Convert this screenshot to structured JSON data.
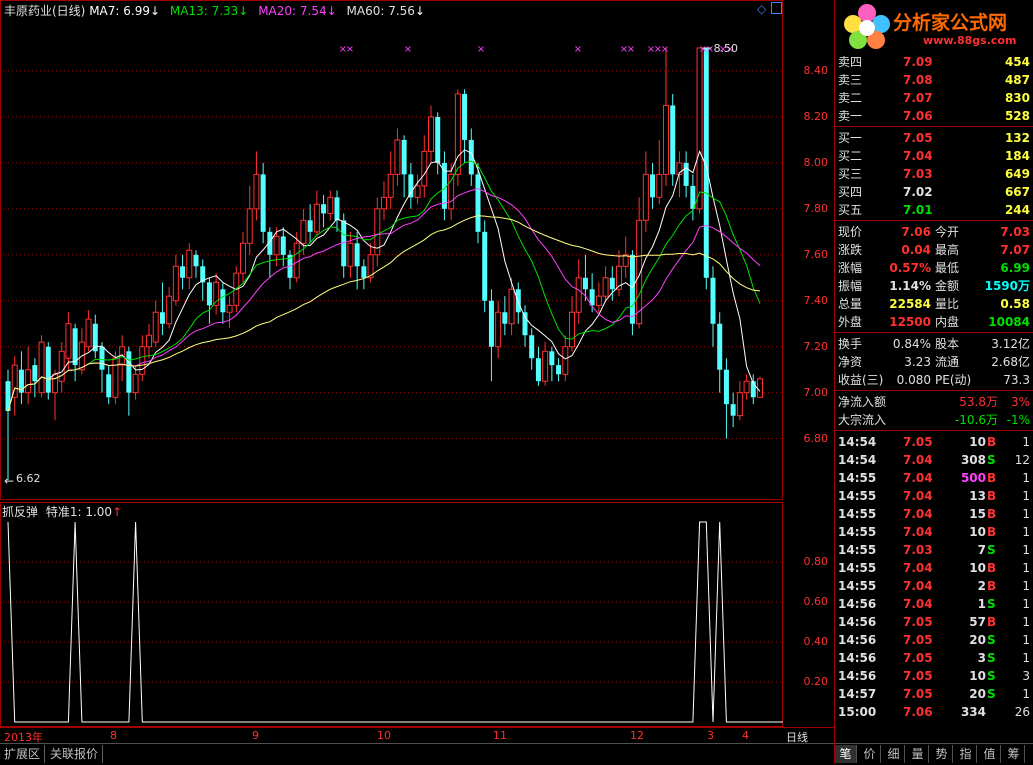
{
  "header": {
    "title": "丰原药业(日线)",
    "ma7": "MA7: 6.99",
    "ma13": "MA13: 7.33",
    "ma20": "MA20: 7.54",
    "ma60": "MA60: 7.56",
    "arrow": "↓"
  },
  "colors": {
    "ma7": "#ffffff",
    "ma13": "#00e000",
    "ma20": "#ff40ff",
    "ma60": "#ffff80",
    "up": "#ff3030",
    "down": "#54ffff",
    "grid": "#a00000"
  },
  "main_axis_ticks": [
    "8.40",
    "8.20",
    "8.00",
    "7.80",
    "7.60",
    "7.40",
    "7.20",
    "7.00",
    "6.80"
  ],
  "main_annotations": {
    "high": "8.50",
    "low": "6.62"
  },
  "sub_header": {
    "name": "抓反弹",
    "param": "特准1: 1.00",
    "arrow": "↑"
  },
  "sub_axis_ticks": [
    "0.80",
    "0.60",
    "0.40",
    "0.20"
  ],
  "dates": [
    "2013年",
    "8",
    "9",
    "10",
    "11",
    "12",
    "3",
    "4"
  ],
  "period_label": "日线",
  "bottom_tabs": [
    "扩展区",
    "关联报价"
  ],
  "panel": {
    "logo_text": "分析家公式网",
    "logo_url": "www.88gs.com",
    "sell": [
      {
        "label": "卖四",
        "price": "7.09",
        "vol": "454"
      },
      {
        "label": "卖三",
        "price": "7.08",
        "vol": "487"
      },
      {
        "label": "卖二",
        "price": "7.07",
        "vol": "830"
      },
      {
        "label": "卖一",
        "price": "7.06",
        "vol": "528"
      }
    ],
    "buy": [
      {
        "label": "买一",
        "price": "7.05",
        "vol": "132"
      },
      {
        "label": "买二",
        "price": "7.04",
        "vol": "184"
      },
      {
        "label": "买三",
        "price": "7.03",
        "vol": "649"
      },
      {
        "label": "买四",
        "price": "7.02",
        "vol": "667"
      },
      {
        "label": "买五",
        "price": "7.01",
        "vol": "244"
      }
    ],
    "stats": [
      {
        "l1": "现价",
        "v1": "7.06",
        "c1": "r",
        "l2": "今开",
        "v2": "7.03",
        "c2": "r"
      },
      {
        "l1": "涨跌",
        "v1": "0.04",
        "c1": "r",
        "l2": "最高",
        "v2": "7.07",
        "c2": "r"
      },
      {
        "l1": "涨幅",
        "v1": "0.57%",
        "c1": "r",
        "l2": "最低",
        "v2": "6.99",
        "c2": "g"
      },
      {
        "l1": "振幅",
        "v1": "1.14%",
        "c1": "w",
        "l2": "金额",
        "v2": "1590万",
        "c2": "cy"
      },
      {
        "l1": "总量",
        "v1": "22584",
        "c1": "y",
        "l2": "量比",
        "v2": "0.58",
        "c2": "y"
      },
      {
        "l1": "外盘",
        "v1": "12500",
        "c1": "r",
        "l2": "内盘",
        "v2": "10084",
        "c2": "g"
      }
    ],
    "stats2": [
      {
        "l1": "换手",
        "v1": "0.84%",
        "l2": "股本",
        "v2": "3.12亿"
      },
      {
        "l1": "净资",
        "v1": "3.23",
        "l2": "流通",
        "v2": "2.68亿"
      },
      {
        "l1": "收益(三)",
        "v1": "0.080",
        "l2": "PE(动)",
        "v2": "73.3"
      }
    ],
    "flow": [
      {
        "label": "净流入额",
        "val": "53.8万",
        "pct": "3%",
        "color": "r"
      },
      {
        "label": "大宗流入",
        "val": "-10.6万",
        "pct": "-1%",
        "color": "g"
      }
    ],
    "ticks": [
      {
        "t": "14:54",
        "p": "7.05",
        "v": "10",
        "bs": "B",
        "n": "1",
        "vc": "w"
      },
      {
        "t": "14:54",
        "p": "7.04",
        "v": "308",
        "bs": "S",
        "n": "12",
        "vc": "w"
      },
      {
        "t": "14:55",
        "p": "7.04",
        "v": "500",
        "bs": "B",
        "n": "1",
        "vc": "mg"
      },
      {
        "t": "14:55",
        "p": "7.04",
        "v": "13",
        "bs": "B",
        "n": "1",
        "vc": "w"
      },
      {
        "t": "14:55",
        "p": "7.04",
        "v": "15",
        "bs": "B",
        "n": "1",
        "vc": "w"
      },
      {
        "t": "14:55",
        "p": "7.04",
        "v": "10",
        "bs": "B",
        "n": "1",
        "vc": "w"
      },
      {
        "t": "14:55",
        "p": "7.03",
        "v": "7",
        "bs": "S",
        "n": "1",
        "vc": "w"
      },
      {
        "t": "14:55",
        "p": "7.04",
        "v": "10",
        "bs": "B",
        "n": "1",
        "vc": "w"
      },
      {
        "t": "14:55",
        "p": "7.04",
        "v": "2",
        "bs": "B",
        "n": "1",
        "vc": "w"
      },
      {
        "t": "14:56",
        "p": "7.04",
        "v": "1",
        "bs": "S",
        "n": "1",
        "vc": "w"
      },
      {
        "t": "14:56",
        "p": "7.05",
        "v": "57",
        "bs": "B",
        "n": "1",
        "vc": "w"
      },
      {
        "t": "14:56",
        "p": "7.05",
        "v": "20",
        "bs": "S",
        "n": "1",
        "vc": "w"
      },
      {
        "t": "14:56",
        "p": "7.05",
        "v": "3",
        "bs": "S",
        "n": "1",
        "vc": "w"
      },
      {
        "t": "14:56",
        "p": "7.05",
        "v": "10",
        "bs": "S",
        "n": "3",
        "vc": "w"
      },
      {
        "t": "14:57",
        "p": "7.05",
        "v": "20",
        "bs": "S",
        "n": "1",
        "vc": "w"
      },
      {
        "t": "15:00",
        "p": "7.06",
        "v": "334",
        "bs": "",
        "n": "26",
        "vc": "w"
      }
    ],
    "tabs": [
      "笔",
      "价",
      "细",
      "量",
      "势",
      "指",
      "值",
      "筹"
    ]
  },
  "chart_data": {
    "type": "candlestick",
    "indicator_signal_levels": [
      0,
      1
    ],
    "ylim": [
      6.62,
      8.5
    ],
    "candles": [
      [
        7.05,
        6.92,
        7.1,
        6.62
      ],
      [
        6.98,
        7.12,
        7.16,
        6.9
      ],
      [
        7.1,
        7.0,
        7.18,
        6.95
      ],
      [
        7.0,
        7.1,
        7.2,
        6.95
      ],
      [
        7.12,
        7.05,
        7.15,
        6.98
      ],
      [
        7.0,
        7.22,
        7.25,
        6.98
      ],
      [
        7.2,
        7.0,
        7.22,
        6.97
      ],
      [
        7.0,
        7.08,
        7.1,
        6.88
      ],
      [
        7.05,
        7.18,
        7.22,
        7.0
      ],
      [
        7.15,
        7.3,
        7.35,
        7.1
      ],
      [
        7.28,
        7.12,
        7.3,
        7.05
      ],
      [
        7.1,
        7.22,
        7.28,
        7.08
      ],
      [
        7.2,
        7.32,
        7.36,
        7.18
      ],
      [
        7.3,
        7.18,
        7.34,
        7.15
      ],
      [
        7.2,
        7.1,
        7.22,
        7.0
      ],
      [
        7.08,
        6.98,
        7.12,
        6.95
      ],
      [
        6.98,
        7.15,
        7.18,
        6.95
      ],
      [
        7.12,
        7.2,
        7.25,
        7.05
      ],
      [
        7.18,
        7.0,
        7.2,
        6.9
      ],
      [
        7.0,
        7.08,
        7.12,
        6.97
      ],
      [
        7.08,
        7.2,
        7.25,
        7.05
      ],
      [
        7.2,
        7.25,
        7.3,
        7.15
      ],
      [
        7.22,
        7.35,
        7.4,
        7.2
      ],
      [
        7.35,
        7.3,
        7.48,
        7.25
      ],
      [
        7.3,
        7.42,
        7.46,
        7.28
      ],
      [
        7.4,
        7.55,
        7.6,
        7.38
      ],
      [
        7.55,
        7.5,
        7.6,
        7.45
      ],
      [
        7.5,
        7.62,
        7.65,
        7.45
      ],
      [
        7.6,
        7.55,
        7.62,
        7.5
      ],
      [
        7.55,
        7.48,
        7.58,
        7.4
      ],
      [
        7.48,
        7.38,
        7.5,
        7.3
      ],
      [
        7.38,
        7.48,
        7.52,
        7.34
      ],
      [
        7.45,
        7.35,
        7.48,
        7.3
      ],
      [
        7.35,
        7.38,
        7.42,
        7.28
      ],
      [
        7.38,
        7.52,
        7.55,
        7.35
      ],
      [
        7.52,
        7.65,
        7.7,
        7.48
      ],
      [
        7.65,
        7.8,
        7.9,
        7.6
      ],
      [
        7.8,
        7.95,
        8.05,
        7.75
      ],
      [
        7.95,
        7.7,
        8.0,
        7.65
      ],
      [
        7.7,
        7.6,
        7.72,
        7.5
      ],
      [
        7.6,
        7.68,
        7.72,
        7.55
      ],
      [
        7.68,
        7.6,
        7.72,
        7.55
      ],
      [
        7.6,
        7.5,
        7.62,
        7.45
      ],
      [
        7.5,
        7.65,
        7.7,
        7.48
      ],
      [
        7.65,
        7.75,
        7.8,
        7.6
      ],
      [
        7.75,
        7.7,
        7.82,
        7.65
      ],
      [
        7.7,
        7.82,
        7.88,
        7.68
      ],
      [
        7.82,
        7.78,
        7.86,
        7.72
      ],
      [
        7.78,
        7.85,
        7.88,
        7.75
      ],
      [
        7.85,
        7.75,
        7.88,
        7.7
      ],
      [
        7.75,
        7.55,
        7.78,
        7.5
      ],
      [
        7.55,
        7.65,
        7.7,
        7.5
      ],
      [
        7.65,
        7.55,
        7.7,
        7.45
      ],
      [
        7.55,
        7.5,
        7.58,
        7.45
      ],
      [
        7.5,
        7.6,
        7.65,
        7.48
      ],
      [
        7.6,
        7.8,
        7.85,
        7.55
      ],
      [
        7.8,
        7.85,
        7.92,
        7.75
      ],
      [
        7.85,
        7.95,
        8.05,
        7.8
      ],
      [
        7.95,
        8.1,
        8.15,
        7.9
      ],
      [
        8.1,
        7.95,
        8.12,
        7.85
      ],
      [
        7.95,
        7.85,
        8.0,
        7.8
      ],
      [
        7.85,
        7.9,
        7.95,
        7.82
      ],
      [
        7.9,
        8.05,
        8.12,
        7.85
      ],
      [
        8.05,
        8.2,
        8.25,
        8.0
      ],
      [
        8.2,
        8.0,
        8.22,
        7.95
      ],
      [
        8.0,
        7.8,
        8.05,
        7.75
      ],
      [
        7.8,
        7.95,
        8.0,
        7.75
      ],
      [
        7.95,
        8.3,
        8.32,
        7.9
      ],
      [
        8.3,
        8.1,
        8.32,
        8.0
      ],
      [
        8.1,
        7.95,
        8.15,
        7.9
      ],
      [
        7.95,
        7.7,
        8.0,
        7.65
      ],
      [
        7.7,
        7.4,
        7.75,
        7.35
      ],
      [
        7.4,
        7.2,
        7.45,
        7.05
      ],
      [
        7.2,
        7.35,
        7.4,
        7.15
      ],
      [
        7.35,
        7.3,
        7.42,
        7.25
      ],
      [
        7.3,
        7.45,
        7.5,
        7.25
      ],
      [
        7.45,
        7.35,
        7.48,
        7.3
      ],
      [
        7.35,
        7.25,
        7.38,
        7.2
      ],
      [
        7.25,
        7.15,
        7.28,
        7.1
      ],
      [
        7.15,
        7.05,
        7.2,
        7.03
      ],
      [
        7.05,
        7.18,
        7.22,
        7.03
      ],
      [
        7.18,
        7.12,
        7.2,
        7.05
      ],
      [
        7.12,
        7.08,
        7.15,
        7.05
      ],
      [
        7.08,
        7.2,
        7.25,
        7.05
      ],
      [
        7.2,
        7.35,
        7.42,
        7.18
      ],
      [
        7.35,
        7.5,
        7.58,
        7.3
      ],
      [
        7.5,
        7.45,
        7.6,
        7.4
      ],
      [
        7.45,
        7.38,
        7.52,
        7.35
      ],
      [
        7.38,
        7.42,
        7.48,
        7.35
      ],
      [
        7.42,
        7.5,
        7.55,
        7.4
      ],
      [
        7.5,
        7.45,
        7.55,
        7.4
      ],
      [
        7.45,
        7.55,
        7.62,
        7.42
      ],
      [
        7.55,
        7.6,
        7.68,
        7.5
      ],
      [
        7.6,
        7.3,
        7.62,
        7.25
      ],
      [
        7.3,
        7.75,
        7.85,
        7.28
      ],
      [
        7.75,
        7.95,
        8.05,
        7.7
      ],
      [
        7.95,
        7.85,
        8.0,
        7.8
      ],
      [
        7.85,
        7.95,
        8.1,
        7.82
      ],
      [
        7.95,
        8.25,
        8.5,
        7.9
      ],
      [
        8.25,
        7.95,
        8.3,
        7.9
      ],
      [
        7.95,
        8.0,
        8.05,
        7.85
      ],
      [
        8.0,
        7.9,
        8.05,
        7.85
      ],
      [
        7.9,
        7.8,
        7.95,
        7.75
      ],
      [
        7.8,
        8.5,
        8.5,
        7.78
      ],
      [
        8.5,
        7.5,
        8.5,
        7.45
      ],
      [
        7.5,
        7.3,
        7.55,
        7.2
      ],
      [
        7.3,
        7.1,
        7.35,
        7.0
      ],
      [
        7.1,
        6.95,
        7.15,
        6.8
      ],
      [
        6.95,
        6.9,
        7.0,
        6.85
      ],
      [
        6.9,
        7.0,
        7.05,
        6.88
      ],
      [
        7.0,
        7.05,
        7.08,
        6.97
      ],
      [
        7.05,
        6.98,
        7.08,
        6.95
      ],
      [
        6.98,
        7.06,
        7.07,
        6.99
      ]
    ],
    "signal": [
      1,
      0,
      0,
      0,
      0,
      0,
      0,
      0,
      0,
      0,
      1,
      0,
      0,
      0,
      0,
      0,
      0,
      0,
      0,
      1,
      0,
      0,
      0,
      0,
      0,
      0,
      0,
      0,
      0,
      0,
      0,
      0,
      0,
      0,
      0,
      0,
      0,
      0,
      0,
      0,
      0,
      0,
      0,
      0,
      0,
      0,
      0,
      0,
      0,
      0,
      0,
      0,
      0,
      0,
      0,
      0,
      0,
      0,
      0,
      0,
      0,
      0,
      0,
      0,
      0,
      0,
      0,
      0,
      0,
      0,
      0,
      0,
      0,
      0,
      0,
      0,
      0,
      0,
      0,
      0,
      0,
      0,
      0,
      0,
      0,
      0,
      0,
      0,
      0,
      0,
      0,
      0,
      0,
      0,
      0,
      0,
      0,
      0,
      0,
      0,
      0,
      0,
      0,
      1,
      1,
      0,
      1,
      0,
      0,
      0,
      0,
      0,
      0,
      0,
      0,
      0,
      0,
      0,
      0,
      0,
      1
    ]
  }
}
